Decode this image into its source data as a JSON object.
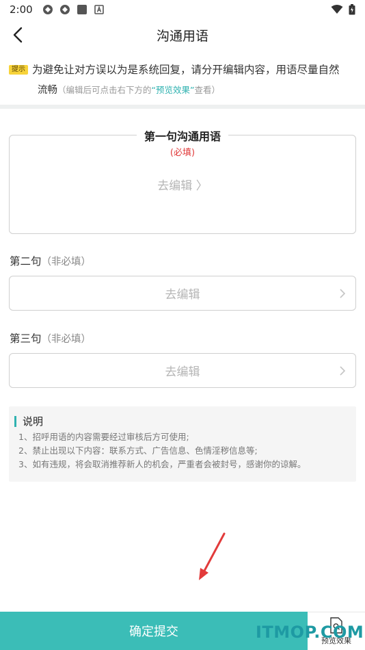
{
  "status": {
    "time": "2:00"
  },
  "nav": {
    "title": "沟通用语"
  },
  "tip": {
    "badge": "提示",
    "text": "为避免让对方误以为是系统回复，请分开编辑内容，用语尽量自然",
    "text_cont": "流畅",
    "sub_prefix": "（编辑后可点击右下方的",
    "sub_link": "“预览效果”",
    "sub_suffix": "查看）"
  },
  "sentences": [
    {
      "title": "第一句沟通用语",
      "required": "(必填)",
      "edit": "去编辑 〉"
    },
    {
      "label": "第二句",
      "optional": "（非必填）",
      "edit": "去编辑"
    },
    {
      "label": "第三句",
      "optional": "（非必填）",
      "edit": "去编辑"
    }
  ],
  "notes": {
    "title": "说明",
    "items": [
      "1、招呼用语的内容需要经过审核后方可使用;",
      "2、禁止出现以下内容：联系方式、广告信息、色情淫秽信息等;",
      "3、如有违规，将会取消推荐新人的机会，严重者会被封号，感谢你的谅解。"
    ]
  },
  "footer": {
    "submit": "确定提交",
    "preview": "预览效果"
  },
  "watermark": "ITMOP.COM",
  "colors": {
    "accent": "#3bbdb7",
    "required": "#e03a3a",
    "badge": "#f7d33a"
  }
}
